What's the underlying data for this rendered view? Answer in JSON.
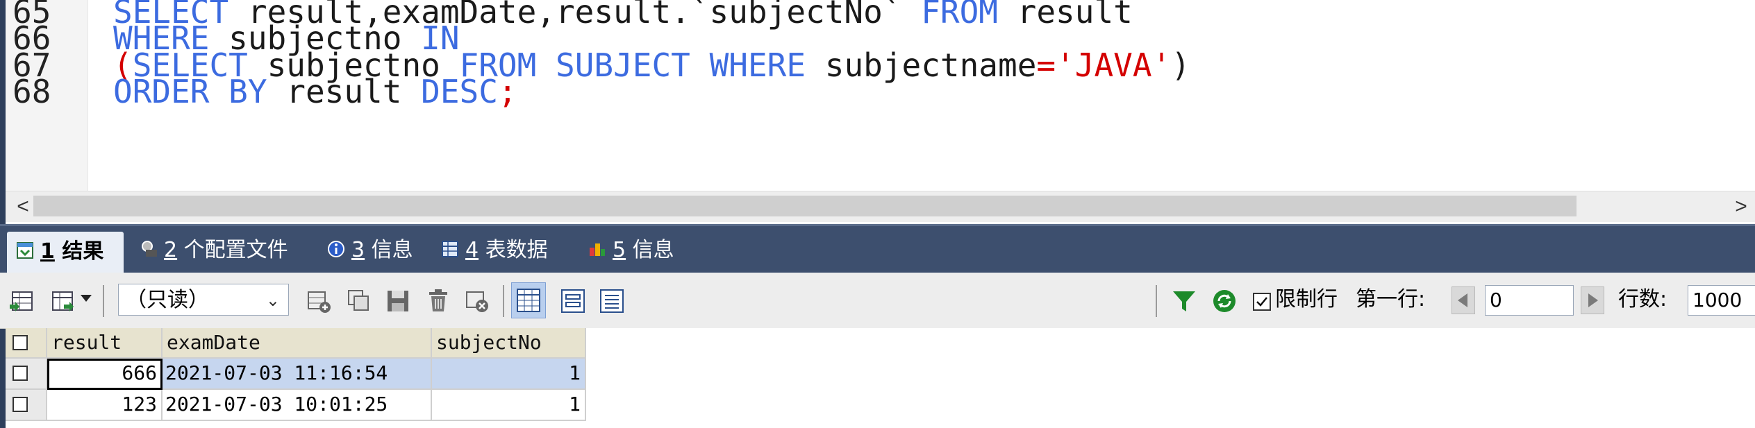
{
  "editor": {
    "lines": [
      {
        "num": "65",
        "tokens": [
          {
            "t": "SELECT ",
            "c": "kw"
          },
          {
            "t": "result,examDate,result.`subjectNo` ",
            "c": "txt"
          },
          {
            "t": "FROM ",
            "c": "kw"
          },
          {
            "t": "result",
            "c": "txt"
          }
        ]
      },
      {
        "num": "66",
        "tokens": [
          {
            "t": "WHERE ",
            "c": "kw"
          },
          {
            "t": "subjectno ",
            "c": "txt"
          },
          {
            "t": "IN",
            "c": "kw"
          }
        ]
      },
      {
        "num": "67",
        "tokens": [
          {
            "t": "(",
            "c": "str"
          },
          {
            "t": "SELECT ",
            "c": "kw"
          },
          {
            "t": "subjectno ",
            "c": "txt"
          },
          {
            "t": "FROM ",
            "c": "kw"
          },
          {
            "t": "SUBJECT ",
            "c": "kw"
          },
          {
            "t": "WHERE ",
            "c": "kw"
          },
          {
            "t": "subjectname",
            "c": "txt"
          },
          {
            "t": "=",
            "c": "str"
          },
          {
            "t": "'JAVA'",
            "c": "str"
          },
          {
            "t": ")",
            "c": "txt"
          }
        ]
      },
      {
        "num": "68",
        "tokens": [
          {
            "t": "ORDER BY ",
            "c": "kw"
          },
          {
            "t": "result ",
            "c": "txt"
          },
          {
            "t": "DESC",
            "c": "kw"
          },
          {
            "t": ";",
            "c": "str"
          }
        ]
      }
    ]
  },
  "scrollbar": {
    "left_arrow": "<",
    "right_arrow": ">"
  },
  "tabs": [
    {
      "num": "1",
      "label": " 结果",
      "icon": "result-grid-icon"
    },
    {
      "num": "2",
      "label": " 个配置文件",
      "icon": "profile-icon"
    },
    {
      "num": "3",
      "label": " 信息",
      "icon": "info-icon"
    },
    {
      "num": "4",
      "label": " 表数据",
      "icon": "table-data-icon"
    },
    {
      "num": "5",
      "label": " 信息",
      "icon": "info-chart-icon"
    }
  ],
  "toolbar": {
    "mode_select": "（只读）",
    "limit_label": "限制行",
    "first_row_label": "第一行:",
    "first_row_value": "0",
    "row_count_label": "行数:",
    "row_count_value": "1000"
  },
  "grid": {
    "columns": [
      "result",
      "examDate",
      "subjectNo"
    ],
    "rows": [
      [
        "666",
        "2021-07-03 11:16:54",
        "1"
      ],
      [
        "123",
        "2021-07-03 10:01:25",
        "1"
      ]
    ]
  },
  "colors": {
    "keyword": "#3c6be0",
    "string": "#d40000",
    "tabbar": "#3d4f6e",
    "header": "#e7e3cf",
    "selected_row": "#c6d6ef"
  }
}
